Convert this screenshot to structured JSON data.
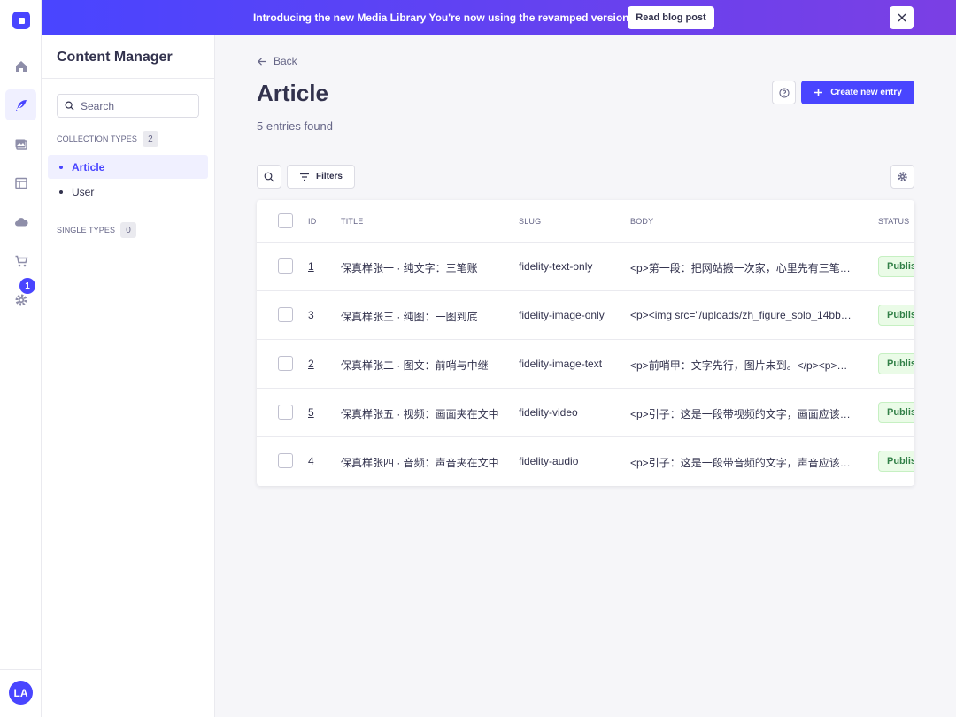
{
  "banner": {
    "text": "Introducing the new Media Library You're now using the revamped version.",
    "button_label": "Read blog post"
  },
  "rail": {
    "logo": "strapi-logo-icon",
    "items": [
      "home-icon",
      "feather-icon",
      "images-icon",
      "layout-icon",
      "cloud-icon",
      "cart-icon",
      "gear-icon"
    ],
    "settings_badge": "1",
    "avatar_initials": "LA"
  },
  "subnav": {
    "title": "Content Manager",
    "search_placeholder": "Search",
    "collection_types_label": "COLLECTION TYPES",
    "collection_types_count": "2",
    "collection_items": [
      {
        "label": "Article",
        "active": true
      },
      {
        "label": "User",
        "active": false
      }
    ],
    "single_types_label": "SINGLE TYPES",
    "single_types_count": "0"
  },
  "header": {
    "back_label": "Back",
    "title": "Article",
    "subtitle": "5 entries found",
    "create_label": "Create new entry"
  },
  "toolbar": {
    "filters_label": "Filters"
  },
  "table": {
    "columns": [
      "ID",
      "TITLE",
      "SLUG",
      "BODY",
      "STATUS"
    ],
    "rows": [
      {
        "id": "1",
        "title": "保真样张一 · 纯文字：三笔账",
        "slug": "fidelity-text-only",
        "body": "<p>第一段：把网站搬一次家，心里先有三笔…",
        "status": "Publis"
      },
      {
        "id": "3",
        "title": "保真样张三 · 纯图：一图到底",
        "slug": "fidelity-image-only",
        "body": "<p><img src=\"/uploads/zh_figure_solo_14bbf…",
        "status": "Publis"
      },
      {
        "id": "2",
        "title": "保真样张二 · 图文：前哨与中继",
        "slug": "fidelity-image-text",
        "body": "<p>前哨甲：文字先行，图片未到。</p><p>…",
        "status": "Publis"
      },
      {
        "id": "5",
        "title": "保真样张五 · 视频：画面夹在文中",
        "slug": "fidelity-video",
        "body": "<p>引子：这是一段带视频的文字，画面应该…",
        "status": "Publis"
      },
      {
        "id": "4",
        "title": "保真样张四 · 音频：声音夹在文中",
        "slug": "fidelity-audio",
        "body": "<p>引子：这是一段带音频的文字，声音应该…",
        "status": "Publis"
      }
    ]
  },
  "colors": {
    "primary": "#4945ff",
    "published_bg": "#eafbe7",
    "published_text": "#328048"
  }
}
